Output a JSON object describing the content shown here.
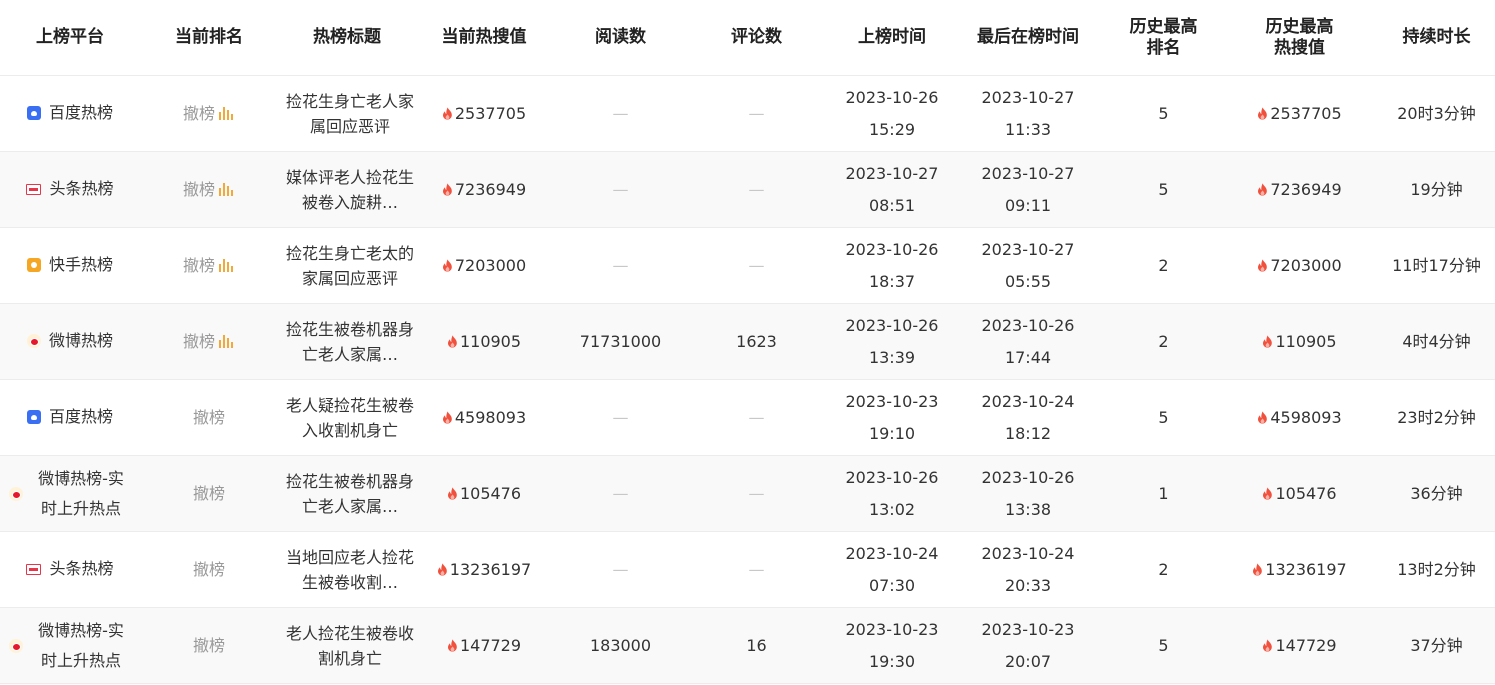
{
  "headers": [
    "上榜平台",
    "当前排名",
    "热榜标题",
    "当前热搜值",
    "阅读数",
    "评论数",
    "上榜时间",
    "最后在榜时间",
    "历史最高排名",
    "历史最高热搜值",
    "持续时长"
  ],
  "rows": [
    {
      "platform": "百度热榜",
      "platform_icon": "baidu-icon",
      "status": "撤榜",
      "show_bars": true,
      "title": "捡花生身亡老人家属回应恶评",
      "current_heat": "2537705",
      "reads": "—",
      "comments": "—",
      "start_date": "2023-10-26",
      "start_time": "15:29",
      "last_date": "2023-10-27",
      "last_time": "11:33",
      "best_rank": "5",
      "best_heat": "2537705",
      "duration": "20时3分钟"
    },
    {
      "platform": "头条热榜",
      "platform_icon": "toutiao-icon",
      "status": "撤榜",
      "show_bars": true,
      "title": "媒体评老人捡花生被卷入旋耕…",
      "current_heat": "7236949",
      "reads": "—",
      "comments": "—",
      "start_date": "2023-10-27",
      "start_time": "08:51",
      "last_date": "2023-10-27",
      "last_time": "09:11",
      "best_rank": "5",
      "best_heat": "7236949",
      "duration": "19分钟"
    },
    {
      "platform": "快手热榜",
      "platform_icon": "kuaishou-icon",
      "status": "撤榜",
      "show_bars": true,
      "title": "捡花生身亡老太的家属回应恶评",
      "current_heat": "7203000",
      "reads": "—",
      "comments": "—",
      "start_date": "2023-10-26",
      "start_time": "18:37",
      "last_date": "2023-10-27",
      "last_time": "05:55",
      "best_rank": "2",
      "best_heat": "7203000",
      "duration": "11时17分钟"
    },
    {
      "platform": "微博热榜",
      "platform_icon": "weibo-icon",
      "status": "撤榜",
      "show_bars": true,
      "title": "捡花生被卷机器身亡老人家属…",
      "current_heat": "110905",
      "reads": "71731000",
      "comments": "1623",
      "start_date": "2023-10-26",
      "start_time": "13:39",
      "last_date": "2023-10-26",
      "last_time": "17:44",
      "best_rank": "2",
      "best_heat": "110905",
      "duration": "4时4分钟"
    },
    {
      "platform": "百度热榜",
      "platform_icon": "baidu-icon",
      "status": "撤榜",
      "show_bars": false,
      "title": "老人疑捡花生被卷入收割机身亡",
      "current_heat": "4598093",
      "reads": "—",
      "comments": "—",
      "start_date": "2023-10-23",
      "start_time": "19:10",
      "last_date": "2023-10-24",
      "last_time": "18:12",
      "best_rank": "5",
      "best_heat": "4598093",
      "duration": "23时2分钟"
    },
    {
      "platform": "微博热榜-实时上升热点",
      "platform_icon": "weibo-icon",
      "status": "撤榜",
      "show_bars": false,
      "title": "捡花生被卷机器身亡老人家属…",
      "current_heat": "105476",
      "reads": "—",
      "comments": "—",
      "start_date": "2023-10-26",
      "start_time": "13:02",
      "last_date": "2023-10-26",
      "last_time": "13:38",
      "best_rank": "1",
      "best_heat": "105476",
      "duration": "36分钟"
    },
    {
      "platform": "头条热榜",
      "platform_icon": "toutiao-icon",
      "status": "撤榜",
      "show_bars": false,
      "title": "当地回应老人捡花生被卷收割…",
      "current_heat": "13236197",
      "reads": "—",
      "comments": "—",
      "start_date": "2023-10-24",
      "start_time": "07:30",
      "last_date": "2023-10-24",
      "last_time": "20:33",
      "best_rank": "2",
      "best_heat": "13236197",
      "duration": "13时2分钟"
    },
    {
      "platform": "微博热榜-实时上升热点",
      "platform_icon": "weibo-icon",
      "status": "撤榜",
      "show_bars": false,
      "title": "老人捡花生被卷收割机身亡",
      "current_heat": "147729",
      "reads": "183000",
      "comments": "16",
      "start_date": "2023-10-23",
      "start_time": "19:30",
      "last_date": "2023-10-23",
      "last_time": "20:07",
      "best_rank": "5",
      "best_heat": "147729",
      "duration": "37分钟"
    }
  ],
  "colors": {
    "fire": "#f0503c",
    "bars": "#f1a93a",
    "muted": "#999999",
    "dash": "#c8c8c8"
  }
}
